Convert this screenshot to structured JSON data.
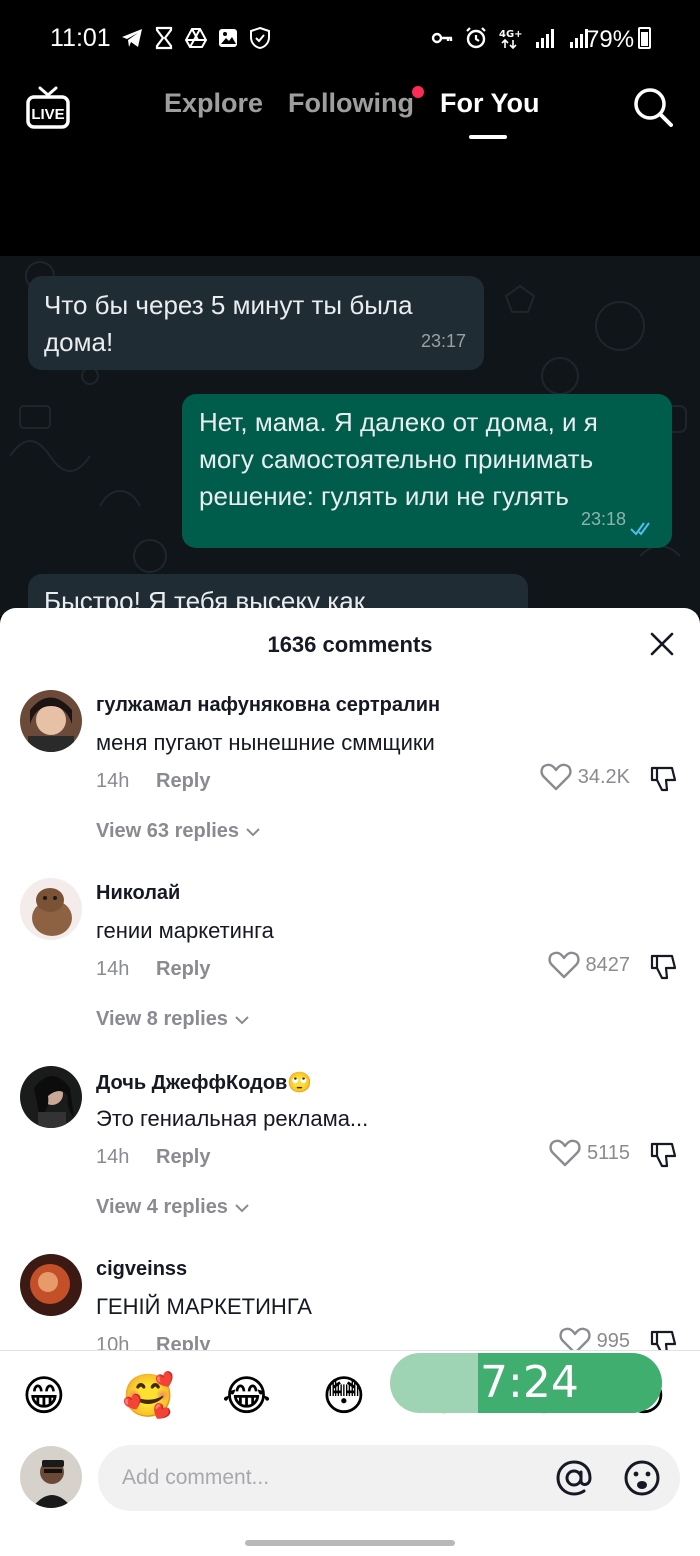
{
  "status_bar": {
    "time": "11:01",
    "battery": "79%",
    "left_icons": [
      "telegram-icon",
      "hourglass-icon",
      "drive-icon",
      "gallery-icon",
      "shield-icon"
    ],
    "right_icons": [
      "key-icon",
      "alarm-icon",
      "4g-icon",
      "signal-icon",
      "signal-icon",
      "battery-icon"
    ]
  },
  "topnav": {
    "live_label": "LIVE",
    "tabs": [
      {
        "label": "Explore",
        "active": false
      },
      {
        "label": "Following",
        "active": false,
        "has_dot": true
      },
      {
        "label": "For You",
        "active": true
      }
    ]
  },
  "video": {
    "messages": [
      {
        "direction": "in",
        "text": "Что бы через 5 минут ты была дома!",
        "time": "23:17"
      },
      {
        "direction": "out",
        "text": "Нет, мама. Я далеко от дома, и я могу самостоятельно принимать решение: гулять или не гулять",
        "time": "23:18"
      },
      {
        "direction": "in",
        "text": "Быстро! Я тебя высеку как",
        "time": ""
      }
    ]
  },
  "comments_sheet": {
    "title": "1636 comments",
    "reply_label": "Reply",
    "comments": [
      {
        "user": "гулжамал нафуняковна сертралин",
        "text": "меня пугают нынешние сммщики",
        "time": "14h",
        "likes": "34.2K",
        "view_replies": "View 63 replies"
      },
      {
        "user": "Николай",
        "text": "гении маркетинга",
        "time": "14h",
        "likes": "8427",
        "view_replies": "View 8 replies"
      },
      {
        "user": "Дочь ДжеффКодов🙄",
        "text": "Это гениальная реклама...",
        "time": "14h",
        "likes": "5115",
        "view_replies": "View 4 replies"
      },
      {
        "user": "cigveinss",
        "text": "ГЕНІЙ МАРКЕТИНГА",
        "time": "10h",
        "likes": "995",
        "view_replies": ""
      }
    ]
  },
  "emoji_bar": {
    "emojis": [
      "😁",
      "🥰",
      "😂",
      "😳",
      "😄",
      "😍",
      "😏"
    ],
    "timer": "7:24"
  },
  "comment_input": {
    "placeholder": "Add comment..."
  }
}
